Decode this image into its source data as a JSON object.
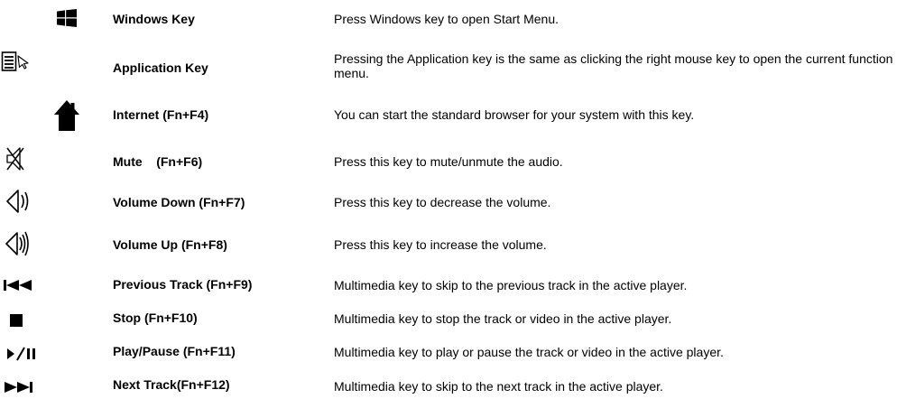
{
  "keys": [
    {
      "icon": "windows-logo-icon",
      "name": "Windows Key",
      "description": "Press Windows key to open Start Menu."
    },
    {
      "icon": "application-menu-icon",
      "name": "Application Key",
      "description": "Pressing the Application key is the same as clicking the right mouse key to open the current function menu."
    },
    {
      "icon": "home-icon",
      "name": "Internet (Fn+F4)",
      "description": "You can start the standard browser for your system with this key."
    },
    {
      "icon": "speaker-muted-icon",
      "name": "Mute    (Fn+F6)",
      "description": "Press this key to mute/unmute the audio."
    },
    {
      "icon": "volume-down-icon",
      "name": "Volume Down (Fn+F7)",
      "description": "Press this key to decrease the volume."
    },
    {
      "icon": "volume-up-icon",
      "name": "Volume Up (Fn+F8)",
      "description": "Press this key to increase the volume."
    },
    {
      "icon": "previous-track-icon",
      "name": "Previous Track (Fn+F9)",
      "description": "Multimedia key to skip to the previous track in the active player."
    },
    {
      "icon": "stop-icon",
      "name": "Stop (Fn+F10)",
      "description": "Multimedia key to stop the track or video in the active player."
    },
    {
      "icon": "play-pause-icon",
      "name": "Play/Pause (Fn+F11)",
      "description": "Multimedia key to play or pause the track or video in the active player."
    },
    {
      "icon": "next-track-icon",
      "name": "Next Track(Fn+F12)",
      "description": "Multimedia key to skip to the next track in the active player."
    }
  ]
}
